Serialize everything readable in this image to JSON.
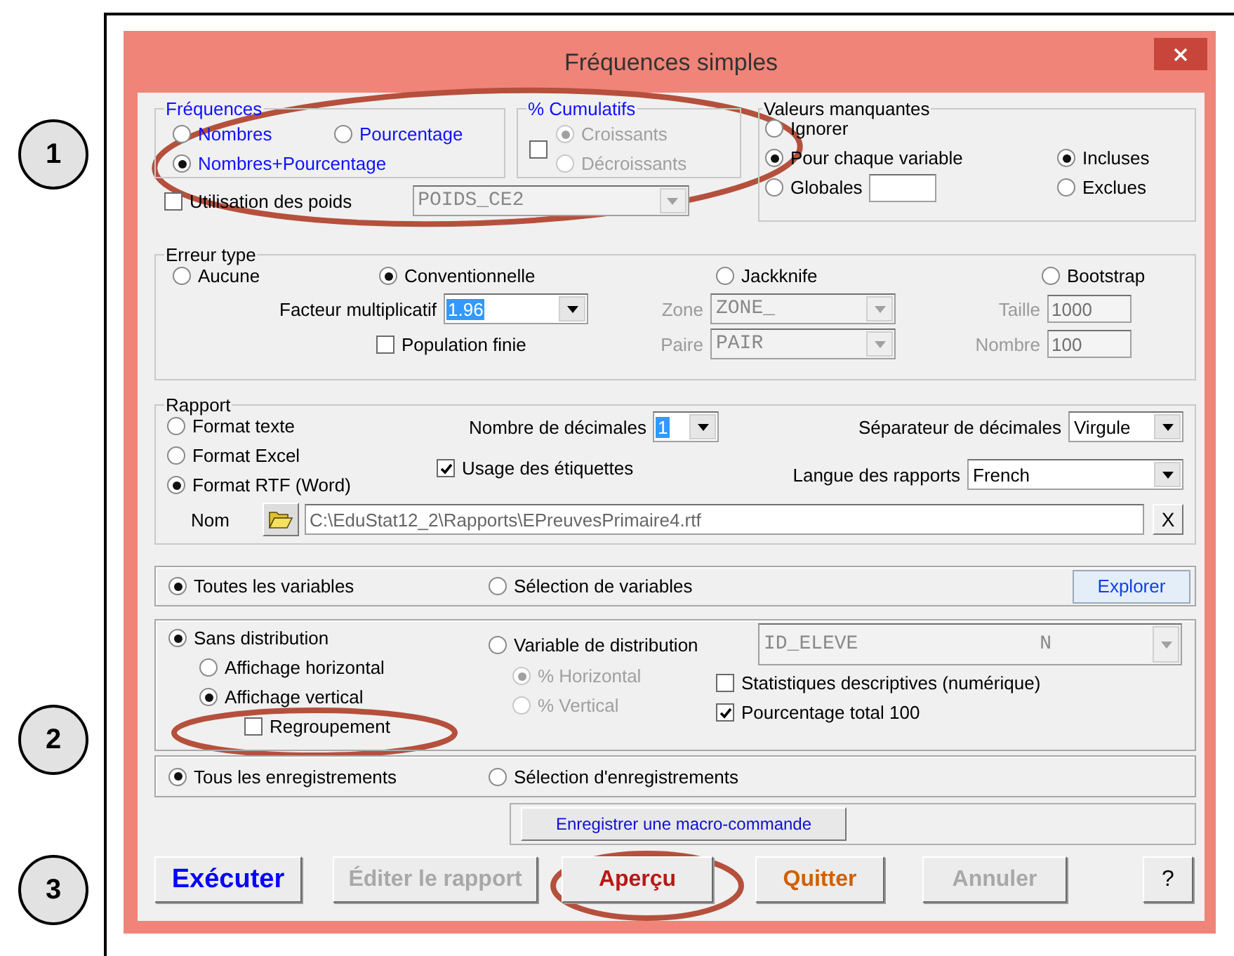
{
  "callouts": [
    "1",
    "2",
    "3"
  ],
  "window": {
    "title": "Fréquences simples"
  },
  "frequences": {
    "label": "Fréquences",
    "options": [
      {
        "label": "Nombres",
        "selected": false
      },
      {
        "label": "Pourcentage",
        "selected": false
      },
      {
        "label": "Nombres+Pourcentage",
        "selected": true
      }
    ]
  },
  "cumulatifs": {
    "label": "% Cumulatifs",
    "checked": false,
    "disabled": true,
    "options": [
      {
        "label": "Croissants",
        "selected": true
      },
      {
        "label": "Décroissants",
        "selected": false
      }
    ]
  },
  "valeurs_manquantes": {
    "label": "Valeurs manquantes",
    "options": [
      {
        "label": "Ignorer",
        "selected": false
      },
      {
        "label": "Pour chaque variable",
        "selected": true
      },
      {
        "label": "Globales",
        "selected": false
      }
    ],
    "sub_options": [
      {
        "label": "Incluses",
        "selected": true
      },
      {
        "label": "Exclues",
        "selected": false
      }
    ]
  },
  "poids": {
    "label": "Utilisation des poids",
    "checked": false,
    "value": "POIDS_CE2",
    "disabled": true
  },
  "erreur_type": {
    "label": "Erreur type",
    "methods": [
      {
        "label": "Aucune",
        "selected": false
      },
      {
        "label": "Conventionnelle",
        "selected": true
      },
      {
        "label": "Jackknife",
        "selected": false
      },
      {
        "label": "Bootstrap",
        "selected": false
      }
    ],
    "facteur": {
      "label": "Facteur multiplicatif",
      "value": "1.96",
      "focused": true
    },
    "population_finie": {
      "label": "Population finie",
      "checked": false
    },
    "zone": {
      "label": "Zone",
      "value": "ZONE_",
      "disabled": true
    },
    "paire": {
      "label": "Paire",
      "value": "PAIR",
      "disabled": true
    },
    "taille": {
      "label": "Taille",
      "value": "1000",
      "disabled": true
    },
    "nombre": {
      "label": "Nombre",
      "value": "100",
      "disabled": true
    }
  },
  "rapport": {
    "label": "Rapport",
    "formats": [
      {
        "label": "Format texte",
        "selected": false
      },
      {
        "label": "Format Excel",
        "selected": false
      },
      {
        "label": "Format RTF (Word)",
        "selected": true
      }
    ],
    "decimales": {
      "label": "Nombre de décimales",
      "value": "1",
      "focused": true
    },
    "etiquettes": {
      "label": "Usage des étiquettes",
      "checked": true
    },
    "separateur": {
      "label": "Séparateur de décimales",
      "value": "Virgule"
    },
    "langue": {
      "label": "Langue des rapports",
      "value": "French"
    },
    "nom": {
      "label": "Nom",
      "value": "C:\\EduStat12_2\\Rapports\\EPreuvesPrimaire4.rtf",
      "clear": "X"
    }
  },
  "variables": {
    "options": [
      {
        "label": "Toutes les variables",
        "selected": true
      },
      {
        "label": "Sélection de variables",
        "selected": false
      }
    ],
    "explore": "Explorer"
  },
  "distribution": {
    "options": [
      {
        "label": "Sans distribution",
        "selected": true
      },
      {
        "label": "Variable de distribution",
        "selected": false
      }
    ],
    "affichage": [
      {
        "label": "Affichage horizontal",
        "selected": false
      },
      {
        "label": "Affichage vertical",
        "selected": true
      }
    ],
    "regroupement": {
      "label": "Regroupement",
      "checked": false
    },
    "variable": {
      "name": "ID_ELEVE",
      "type": "N"
    },
    "percent": {
      "disabled": true,
      "options": [
        {
          "label": "% Horizontal",
          "selected": true
        },
        {
          "label": "% Vertical",
          "selected": false
        }
      ]
    },
    "stats": {
      "label": "Statistiques descriptives (numérique)",
      "checked": false
    },
    "total": {
      "label": "Pourcentage total 100",
      "checked": true
    }
  },
  "enregistrements": {
    "options": [
      {
        "label": "Tous les enregistrements",
        "selected": true
      },
      {
        "label": "Sélection d'enregistrements",
        "selected": false
      }
    ]
  },
  "macro_button": "Enregistrer une macro-commande",
  "buttons": [
    {
      "label": "Exécuter",
      "kind": "primary"
    },
    {
      "label": "Éditer le rapport",
      "kind": "disabled"
    },
    {
      "label": "Aperçu",
      "kind": "preview"
    },
    {
      "label": "Quitter",
      "kind": "quit"
    },
    {
      "label": "Annuler",
      "kind": "disabled"
    },
    {
      "label": "?",
      "kind": "help"
    }
  ]
}
